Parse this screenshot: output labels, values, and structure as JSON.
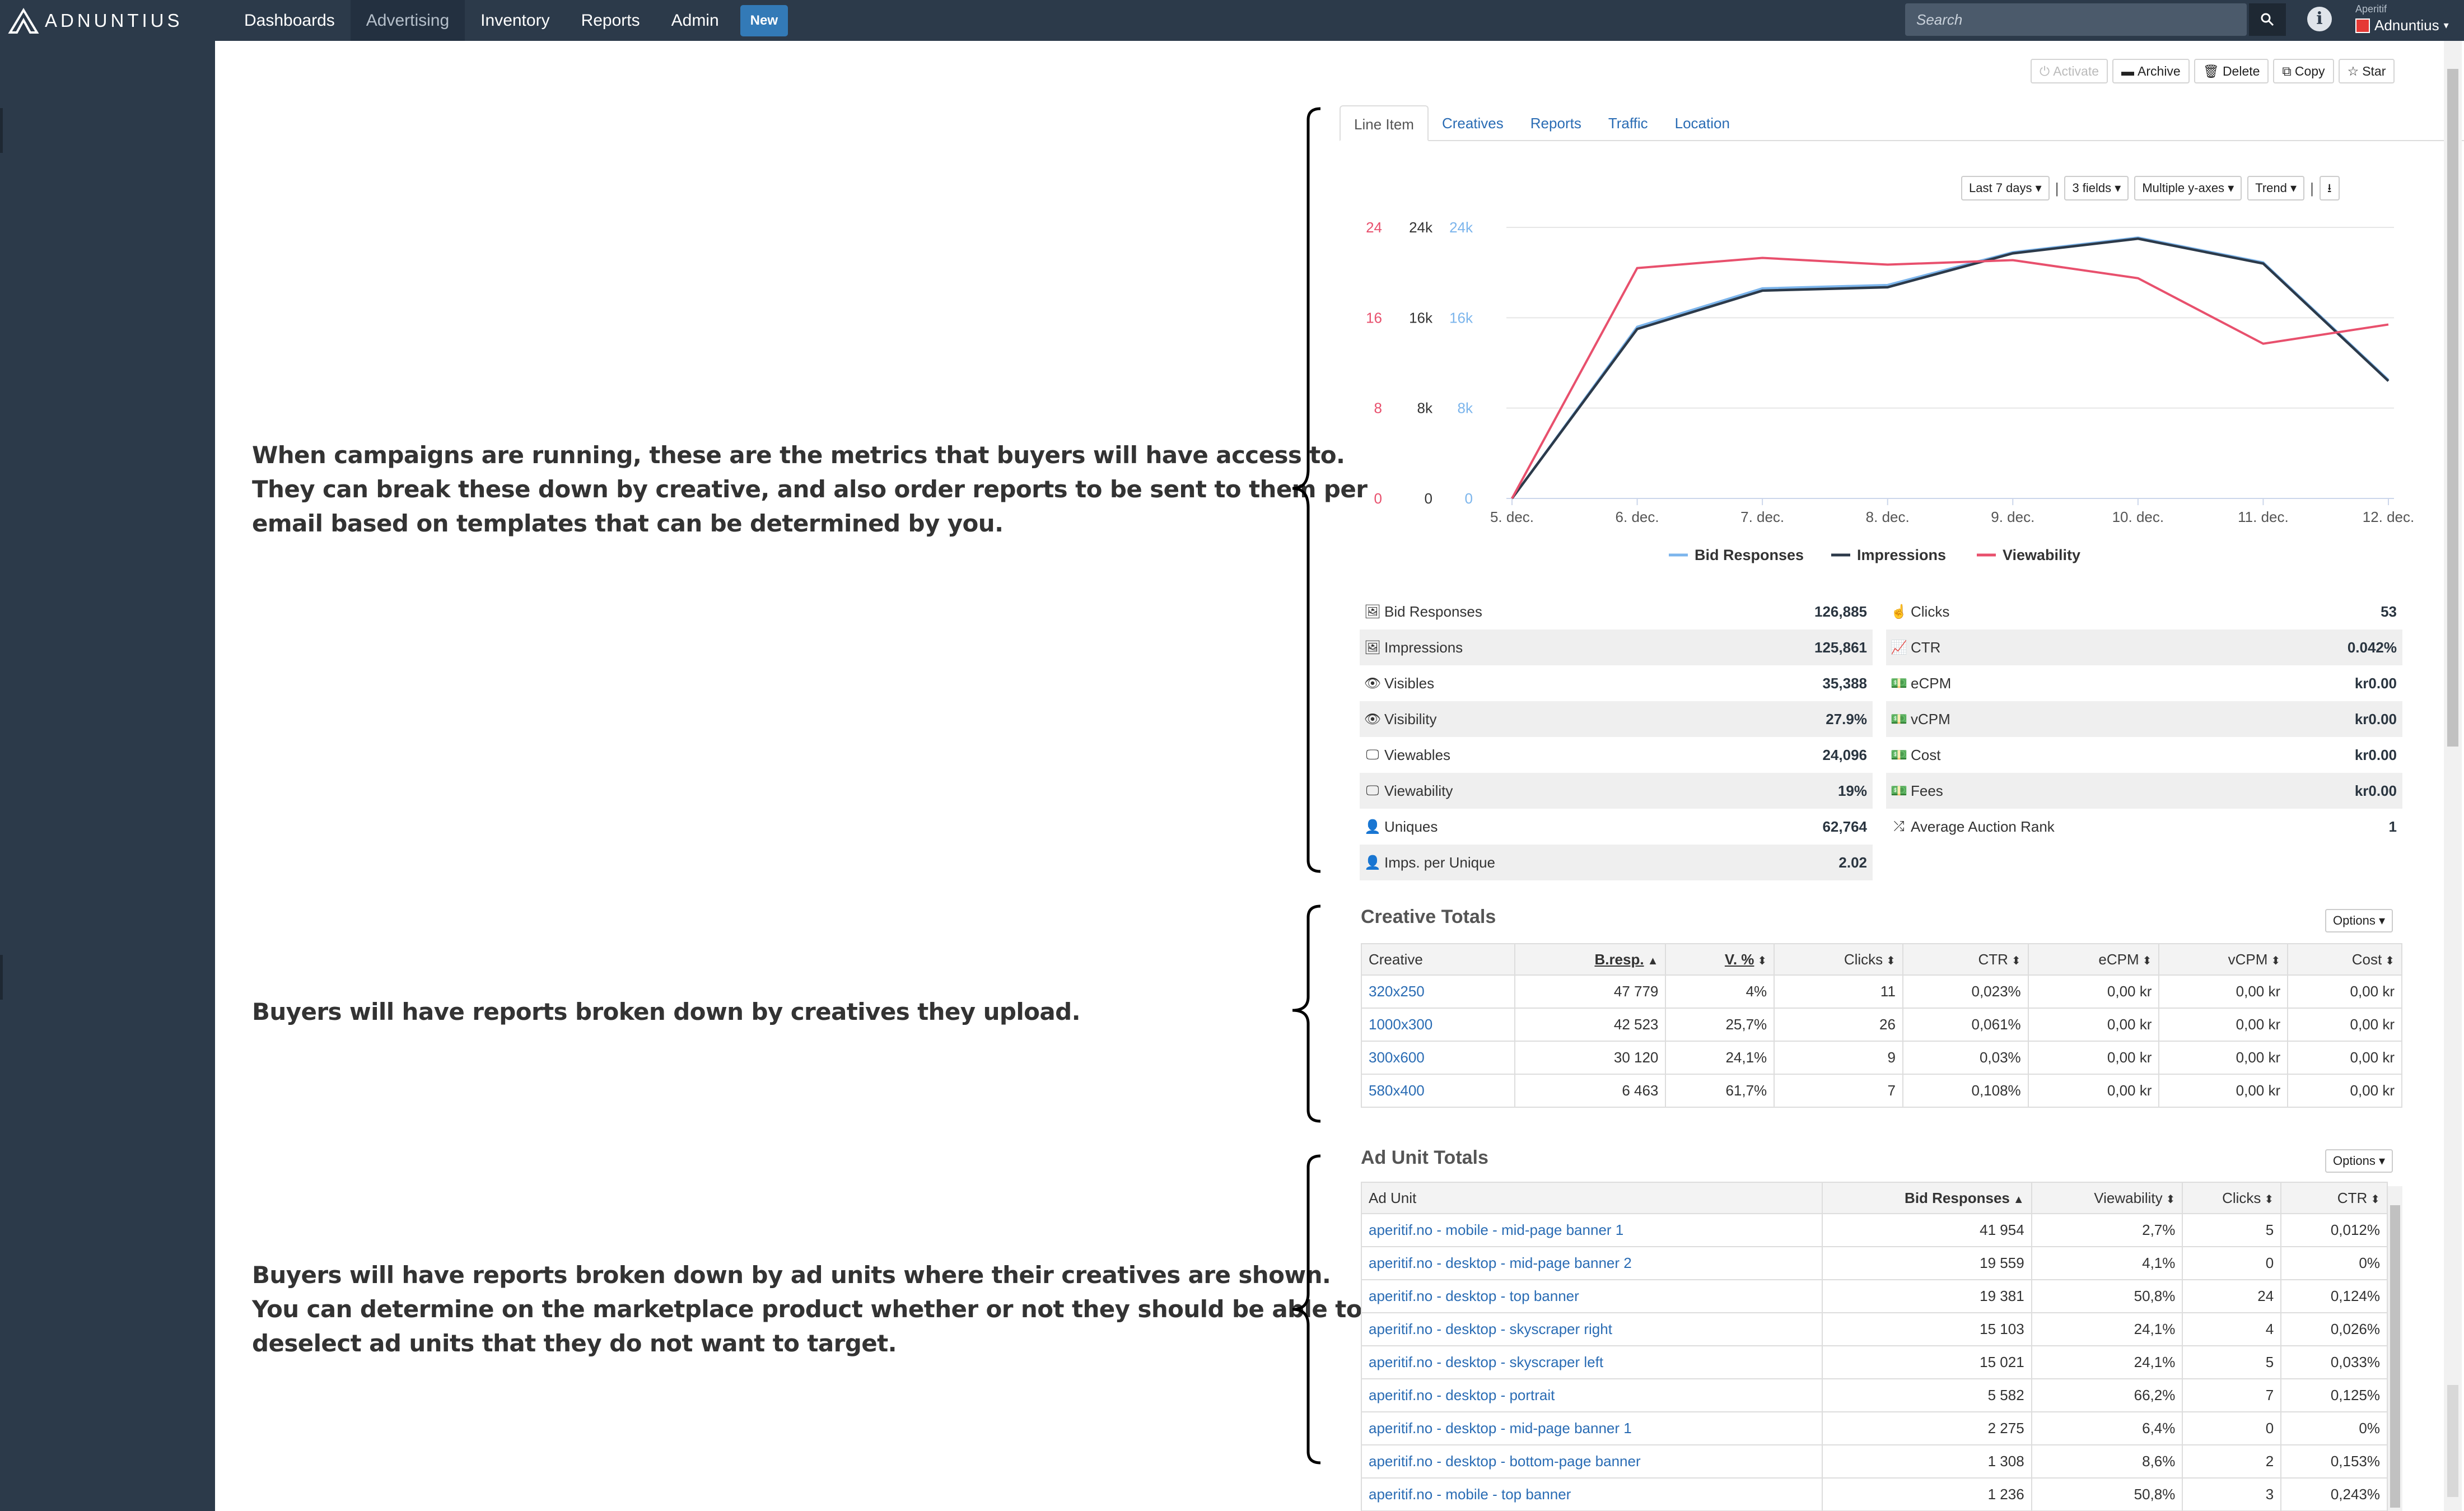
{
  "nav": {
    "brand": "ADNUNTIUS",
    "menu": [
      "Dashboards",
      "Advertising",
      "Inventory",
      "Reports",
      "Admin"
    ],
    "new_label": "New",
    "search_placeholder": "Search",
    "org_small": "Aperitif",
    "org_name": "Adnuntius"
  },
  "annotations": {
    "a1": [
      "When campaigns are running, these are the metrics that buyers will have access to.",
      "They can break these down by creative, and also order reports to be sent to them per",
      "email based on templates that can be determined by you."
    ],
    "a2": [
      "Buyers will have reports broken down by creatives they upload."
    ],
    "a3": [
      "Buyers will have reports broken down by ad units where their creatives are shown.",
      "You can determine on the marketplace product whether or not they should be able to",
      "deselect ad units that they do not want to target."
    ]
  },
  "actions": [
    "Activate",
    "Archive",
    "Delete",
    "Copy",
    "Star"
  ],
  "tabs": [
    "Line Item",
    "Creatives",
    "Reports",
    "Traffic",
    "Location"
  ],
  "chart_tools": [
    "Last 7 days",
    "3 fields",
    "Multiple y-axes",
    "Trend"
  ],
  "chart_data": {
    "type": "line",
    "x": [
      "5. dec.",
      "6. dec.",
      "7. dec.",
      "8. dec.",
      "9. dec.",
      "10. dec.",
      "11. dec.",
      "12. dec."
    ],
    "axes": [
      {
        "ticks": [
          "24",
          "16",
          "8",
          "0"
        ],
        "color": "#e8506d"
      },
      {
        "ticks": [
          "24k",
          "16k",
          "8k",
          "0"
        ],
        "color": "#333333"
      },
      {
        "ticks": [
          "24k",
          "16k",
          "8k",
          "0"
        ],
        "color": "#7cb5ec"
      }
    ],
    "ylim": [
      0,
      24
    ],
    "series": [
      {
        "name": "Bid Responses",
        "color": "#7cb5ec",
        "values": [
          0,
          15200,
          18600,
          18900,
          21800,
          23100,
          20900,
          10500
        ]
      },
      {
        "name": "Impressions",
        "color": "#2c3a4a",
        "values": [
          0,
          15000,
          18400,
          18700,
          21700,
          23000,
          20800,
          10400
        ]
      },
      {
        "name": "Viewability",
        "color": "#e8506d",
        "values": [
          0,
          20.4,
          21.3,
          20.7,
          21.1,
          19.5,
          13.7,
          15.4
        ]
      }
    ]
  },
  "stats_left": [
    {
      "icon": "image-icon",
      "label": "Bid Responses",
      "value": "126,885"
    },
    {
      "icon": "image-icon",
      "label": "Impressions",
      "value": "125,861"
    },
    {
      "icon": "eye-icon",
      "label": "Visibles",
      "value": "35,388"
    },
    {
      "icon": "eye-icon",
      "label": "Visibility",
      "value": "27.9%"
    },
    {
      "icon": "desktop-icon",
      "label": "Viewables",
      "value": "24,096"
    },
    {
      "icon": "desktop-icon",
      "label": "Viewability",
      "value": "19%"
    },
    {
      "icon": "user-icon",
      "label": "Uniques",
      "value": "62,764"
    },
    {
      "icon": "user-icon",
      "label": "Imps. per Unique",
      "value": "2.02"
    }
  ],
  "stats_right": [
    {
      "icon": "pointer-icon",
      "label": "Clicks",
      "value": "53"
    },
    {
      "icon": "line-chart-icon",
      "label": "CTR",
      "value": "0.042%"
    },
    {
      "icon": "money-icon",
      "label": "eCPM",
      "value": "kr0.00"
    },
    {
      "icon": "money-icon",
      "label": "vCPM",
      "value": "kr0.00"
    },
    {
      "icon": "money-icon",
      "label": "Cost",
      "value": "kr0.00"
    },
    {
      "icon": "money-icon",
      "label": "Fees",
      "value": "kr0.00"
    },
    {
      "icon": "random-icon",
      "label": "Average Auction Rank",
      "value": "1"
    }
  ],
  "creative_totals": {
    "title": "Creative Totals",
    "options": "Options",
    "headers": [
      "Creative",
      "B.resp.",
      "V. %",
      "Clicks",
      "CTR",
      "eCPM",
      "vCPM",
      "Cost"
    ],
    "rows": [
      [
        "320x250",
        "47 779",
        "4%",
        "11",
        "0,023%",
        "0,00 kr",
        "0,00 kr",
        "0,00 kr"
      ],
      [
        "1000x300",
        "42 523",
        "25,7%",
        "26",
        "0,061%",
        "0,00 kr",
        "0,00 kr",
        "0,00 kr"
      ],
      [
        "300x600",
        "30 120",
        "24,1%",
        "9",
        "0,03%",
        "0,00 kr",
        "0,00 kr",
        "0,00 kr"
      ],
      [
        "580x400",
        "6 463",
        "61,7%",
        "7",
        "0,108%",
        "0,00 kr",
        "0,00 kr",
        "0,00 kr"
      ]
    ]
  },
  "ad_unit_totals": {
    "title": "Ad Unit Totals",
    "options": "Options",
    "headers": [
      "Ad Unit",
      "Bid Responses",
      "Viewability",
      "Clicks",
      "CTR"
    ],
    "rows": [
      [
        "aperitif.no - mobile - mid-page banner 1",
        "41 954",
        "2,7%",
        "5",
        "0,012%"
      ],
      [
        "aperitif.no - desktop - mid-page banner 2",
        "19 559",
        "4,1%",
        "0",
        "0%"
      ],
      [
        "aperitif.no - desktop - top banner",
        "19 381",
        "50,8%",
        "24",
        "0,124%"
      ],
      [
        "aperitif.no - desktop - skyscraper right",
        "15 103",
        "24,1%",
        "4",
        "0,026%"
      ],
      [
        "aperitif.no - desktop - skyscraper left",
        "15 021",
        "24,1%",
        "5",
        "0,033%"
      ],
      [
        "aperitif.no - desktop - portrait",
        "5 582",
        "66,2%",
        "7",
        "0,125%"
      ],
      [
        "aperitif.no - desktop - mid-page banner 1",
        "2 275",
        "6,4%",
        "0",
        "0%"
      ],
      [
        "aperitif.no - desktop - bottom-page banner",
        "1 308",
        "8,6%",
        "2",
        "0,153%"
      ],
      [
        "aperitif.no - mobile - top banner",
        "1 236",
        "50,8%",
        "3",
        "0,243%"
      ]
    ]
  }
}
